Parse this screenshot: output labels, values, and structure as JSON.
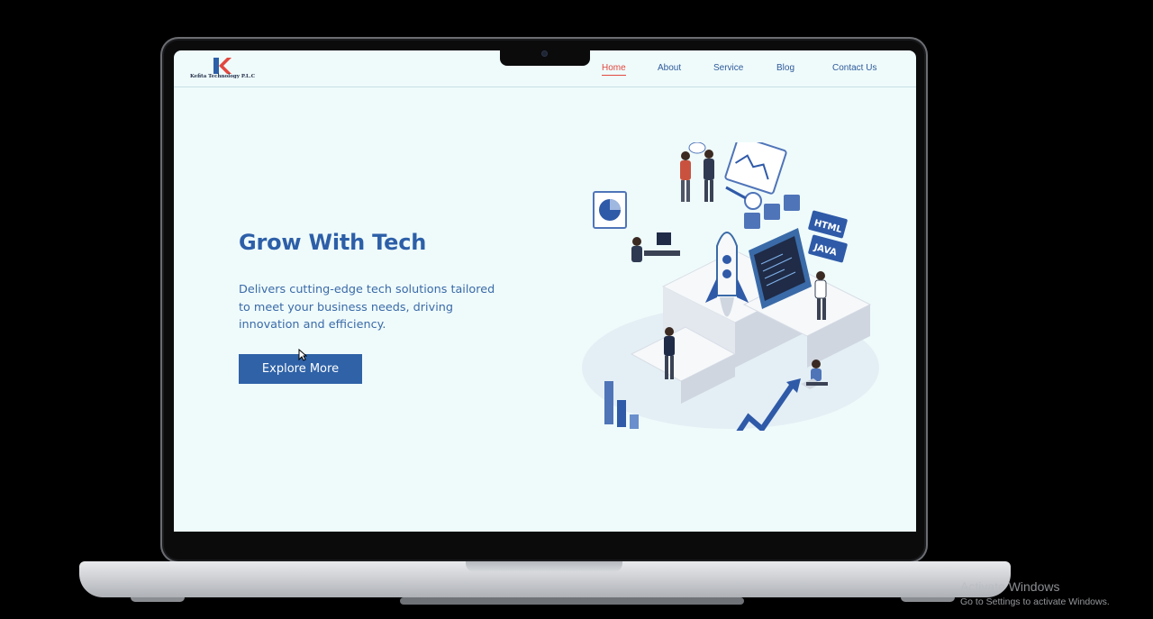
{
  "brand": {
    "name": "Kefita Technology P.L.C",
    "logo_letter": "K",
    "accent": "#e2483f",
    "primary": "#2d5fa8"
  },
  "nav": {
    "home": "Home",
    "about": "About",
    "service": "Service",
    "blog": "Blog",
    "contact": "Contact Us",
    "active": "Home"
  },
  "hero": {
    "title": "Grow With Tech",
    "subtitle": "Delivers cutting-edge tech solutions tailored to meet your business needs, driving innovation and efficiency.",
    "cta_label": "Explore More",
    "illustration": {
      "code_labels": [
        "HTML",
        "JAVA"
      ],
      "chat_bubble": "..."
    }
  },
  "os_watermark": {
    "title": "Activate Windows",
    "subtitle": "Go to Settings to activate Windows."
  }
}
